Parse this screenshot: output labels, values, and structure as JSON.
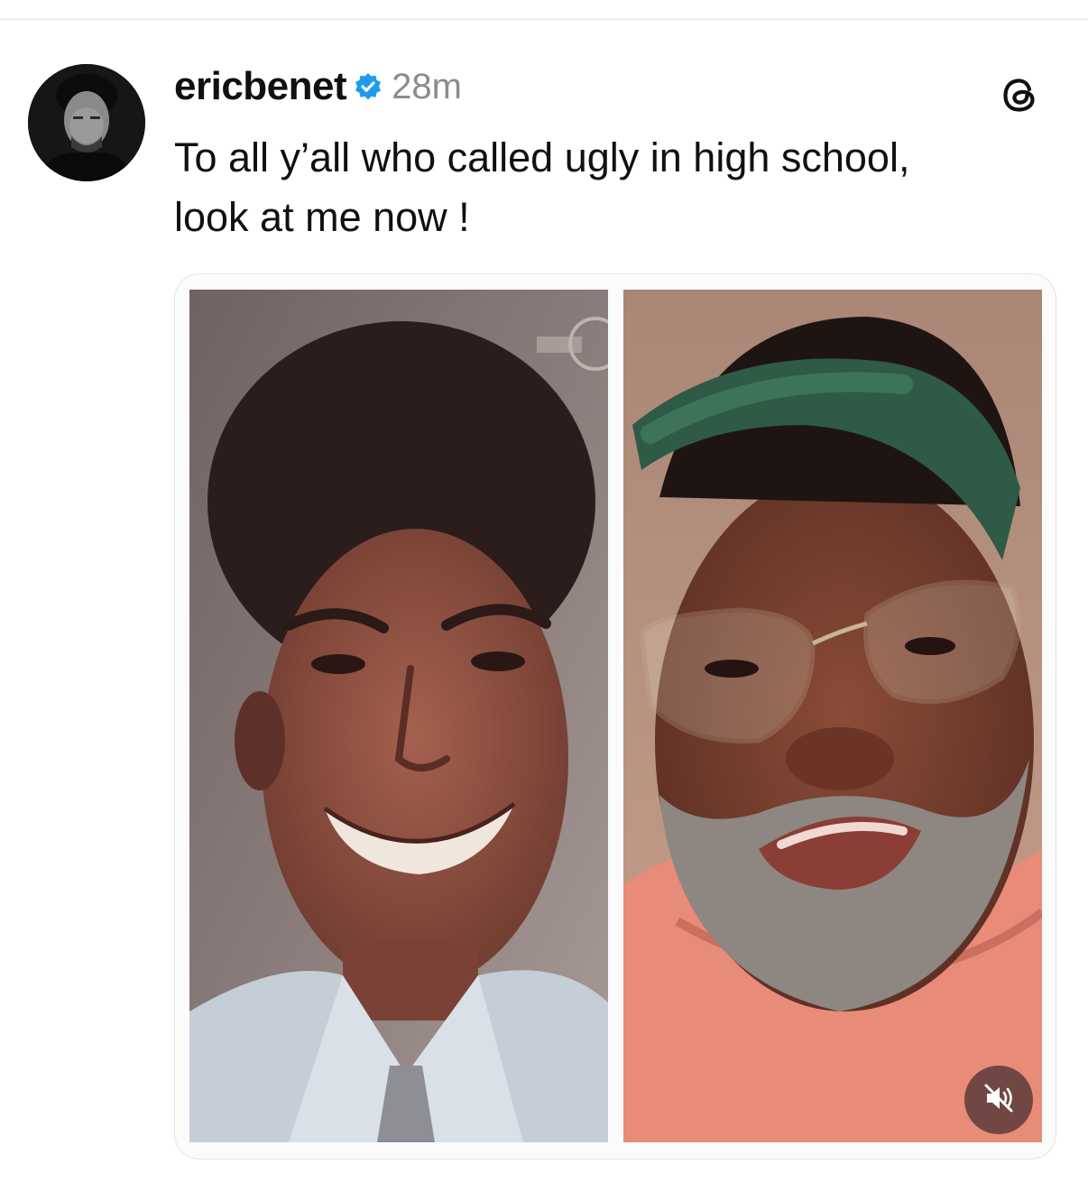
{
  "post": {
    "username": "ericbenet",
    "verified": true,
    "timestamp": "28m",
    "text_lines": [
      "To all y’all who called ugly in high school,",
      "look at me now !"
    ]
  },
  "media": {
    "photos": [
      "yearbook-portrait",
      "recent-selfie"
    ],
    "video_muted": true
  },
  "icons": {
    "verified": "verified-badge-icon",
    "app": "threads-logo-icon",
    "mute": "speaker-muted-icon"
  },
  "colors": {
    "verified_blue": "#1d9bf0",
    "text": "#101010",
    "muted_text": "#8c8c8c",
    "mute_button_bg": "#503434"
  }
}
